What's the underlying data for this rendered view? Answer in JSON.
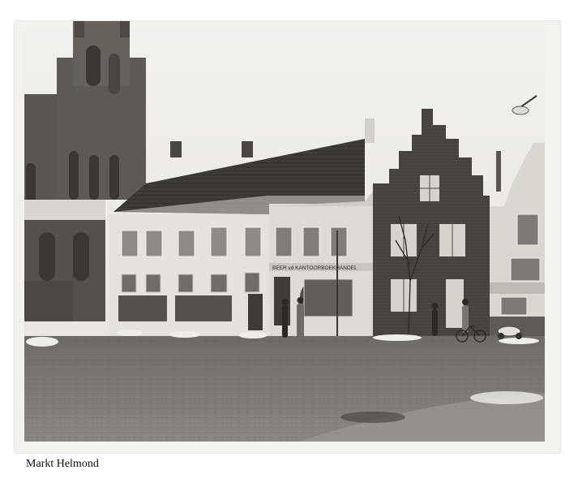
{
  "caption": "Markt Helmond",
  "photo": {
    "shop_sign": "BEER vd KANTOORBOEKHANDEL",
    "tone": "sepia black-and-white"
  }
}
